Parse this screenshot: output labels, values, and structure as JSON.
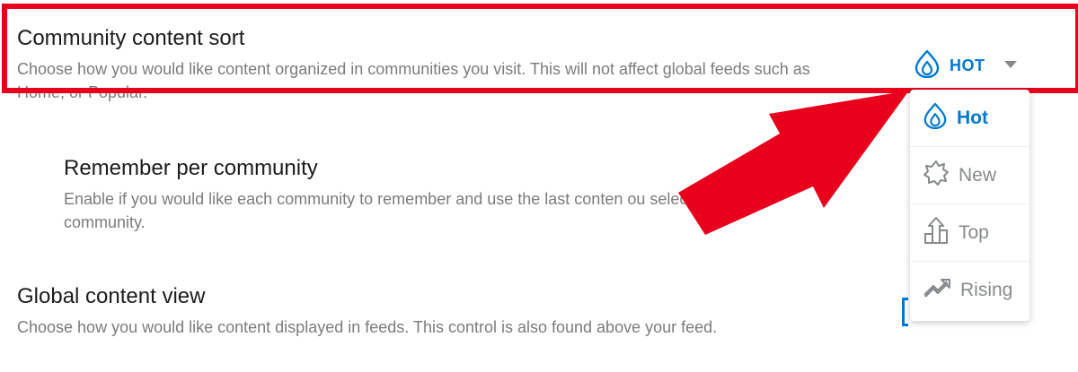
{
  "community_sort": {
    "title": "Community content sort",
    "description": "Choose how you would like content organized in communities you visit. This will not affect global feeds such as Home, or Popular.",
    "selected_label": "HOT"
  },
  "remember_per_community": {
    "title": "Remember per community",
    "description": "Enable if you would like each community to remember and use the last conten  ou selected for that community."
  },
  "global_view": {
    "title": "Global content view",
    "description": "Choose how you would like content displayed in feeds. This control is also found above your feed."
  },
  "dropdown": {
    "items": [
      {
        "label": "Hot",
        "icon": "flame-icon",
        "active": true
      },
      {
        "label": "New",
        "icon": "burst-icon",
        "active": false
      },
      {
        "label": "Top",
        "icon": "top-chart-icon",
        "active": false
      },
      {
        "label": "Rising",
        "icon": "rising-icon",
        "active": false
      }
    ]
  },
  "colors": {
    "accent": "#0079d3",
    "highlight": "#e8001c",
    "muted_text": "#7c7c7c",
    "title_text": "#1c1c1c"
  }
}
